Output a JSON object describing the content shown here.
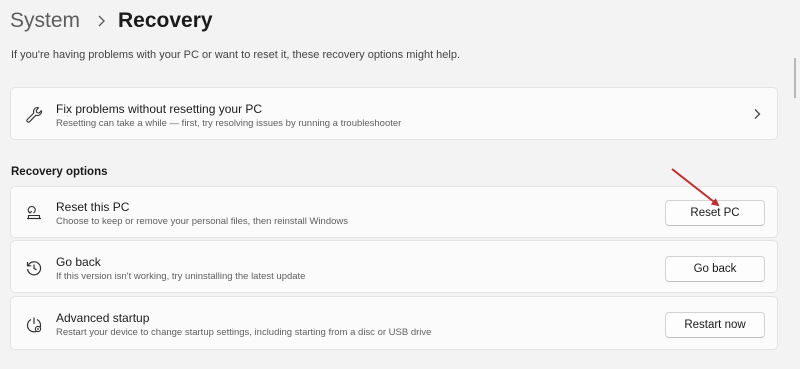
{
  "breadcrumb": {
    "parent": "System",
    "current": "Recovery"
  },
  "intro": "If you're having problems with your PC or want to reset it, these recovery options might help.",
  "fix_card": {
    "icon": "wrench-icon",
    "title": "Fix problems without resetting your PC",
    "description": "Resetting can take a while — first, try resolving issues by running a troubleshooter"
  },
  "recovery_options": {
    "heading": "Recovery options",
    "reset": {
      "icon": "reset-pc-icon",
      "title": "Reset this PC",
      "description": "Choose to keep or remove your personal files, then reinstall Windows",
      "button": "Reset PC"
    },
    "go_back": {
      "icon": "history-icon",
      "title": "Go back",
      "description": "If this version isn't working, try uninstalling the latest update",
      "button": "Go back"
    },
    "advanced_startup": {
      "icon": "advanced-startup-icon",
      "title": "Advanced startup",
      "description": "Restart your device to change startup settings, including starting from a disc or USB drive",
      "button": "Restart now"
    }
  },
  "annotation_arrow_color": "#c42b2b"
}
